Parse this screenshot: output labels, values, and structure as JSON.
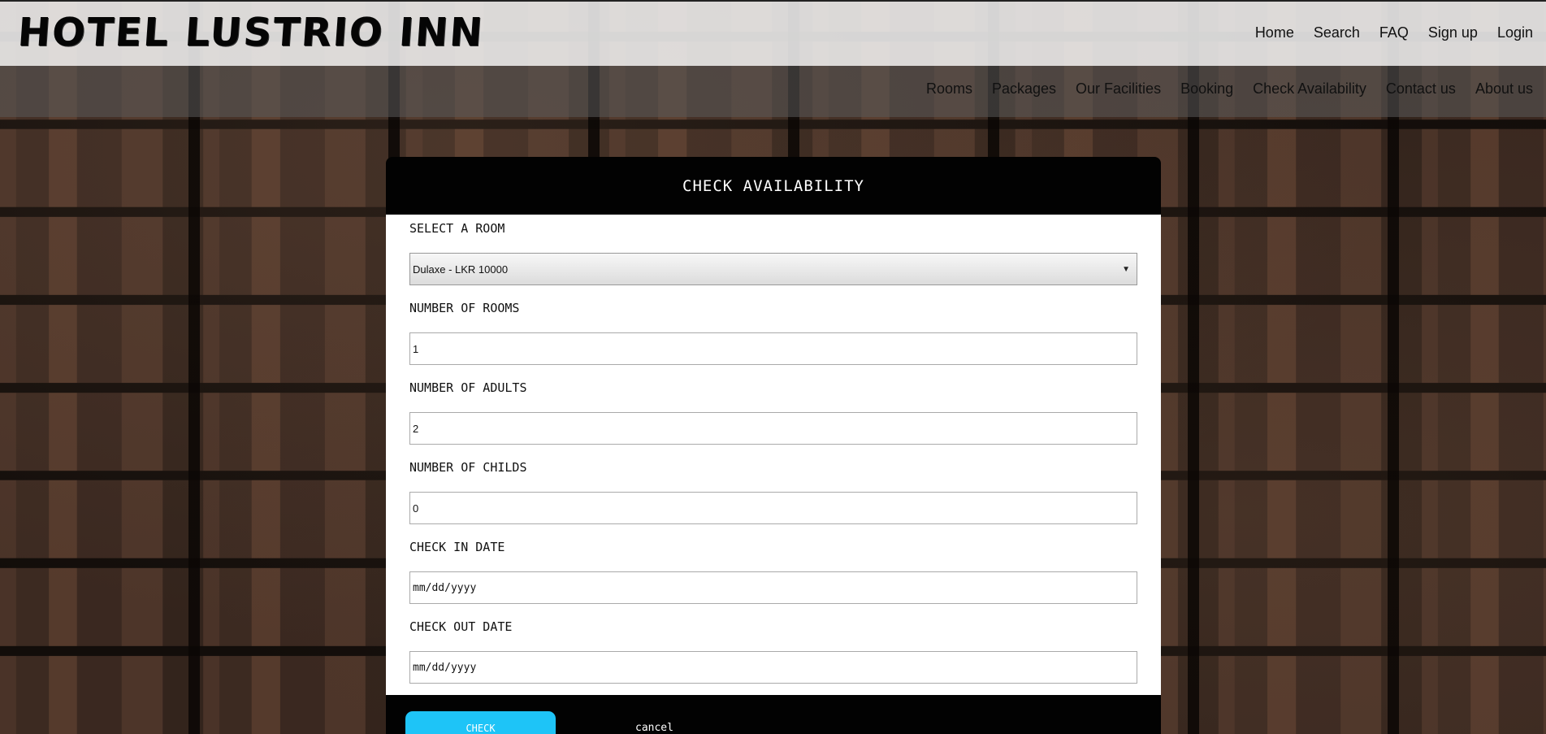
{
  "header": {
    "logo": "HOTEL LUSTRIO INN",
    "top_nav": [
      "Home",
      "Search",
      "FAQ",
      "Sign up",
      "Login"
    ],
    "main_nav": [
      "Rooms",
      "Packages",
      "Our Facilities",
      "Booking",
      "Check Availability",
      "Contact us",
      "About us"
    ]
  },
  "form": {
    "title": "CHECK AVAILABILITY",
    "room_label": "SELECT A ROOM",
    "room_value": "Dulaxe - LKR 10000",
    "rooms_label": "NUMBER OF ROOMS",
    "rooms_value": "1",
    "adults_label": "NUMBER OF ADULTS",
    "adults_value": "2",
    "childs_label": "NUMBER OF CHILDS",
    "childs_value": "0",
    "checkin_label": "CHECK IN DATE",
    "checkin_placeholder": "mm/dd/yyyy",
    "checkout_label": "CHECK OUT DATE",
    "checkout_placeholder": "mm/dd/yyyy",
    "check_button": "CHECK",
    "cancel_button": "cancel"
  },
  "colors": {
    "accent": "#1ec4f7",
    "panel_dark": "#020202"
  },
  "icons": {
    "select_caret": "chevron-down-icon"
  }
}
